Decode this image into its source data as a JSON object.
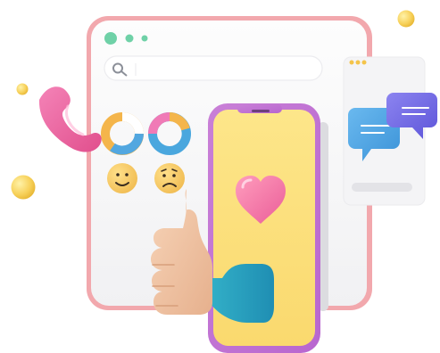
{
  "illustration": {
    "browser_window": {
      "search": {
        "placeholder": "",
        "value": "",
        "icon": "search-icon"
      },
      "window_dots": [
        "dot-1",
        "dot-2",
        "dot-3"
      ],
      "charts": [
        {
          "name": "donut-chart-blue-orange",
          "colors": [
            "#f4b54b",
            "#52a7e0",
            "#ffffff"
          ]
        },
        {
          "name": "donut-chart-pink-orange-blue",
          "colors": [
            "#f07ab6",
            "#f4b54b",
            "#4aa7de"
          ]
        }
      ],
      "faces": [
        {
          "name": "happy-face-icon",
          "color": "#f6c65a"
        },
        {
          "name": "sad-face-icon",
          "color": "#f6c65a"
        }
      ]
    },
    "phone": {
      "icon": "heart-icon",
      "screen_color": "#fbe68a",
      "frame_color": "#c47ad6"
    },
    "chat_panel": {
      "icons": [
        "chat-bubble-blue-icon",
        "chat-bubble-purple-icon"
      ]
    },
    "decorations": {
      "hand": "thumbs-up-icon",
      "phone_receiver": "phone-receiver-icon"
    },
    "palette": {
      "window_border": "#f2a8ad",
      "window_bg": "#f4f4f6",
      "accent_green": "#6fd1a7",
      "pink": "#ec5f98",
      "gold": "#f7cd4a",
      "blue": "#4aa7de",
      "purple": "#6f67e3"
    }
  }
}
